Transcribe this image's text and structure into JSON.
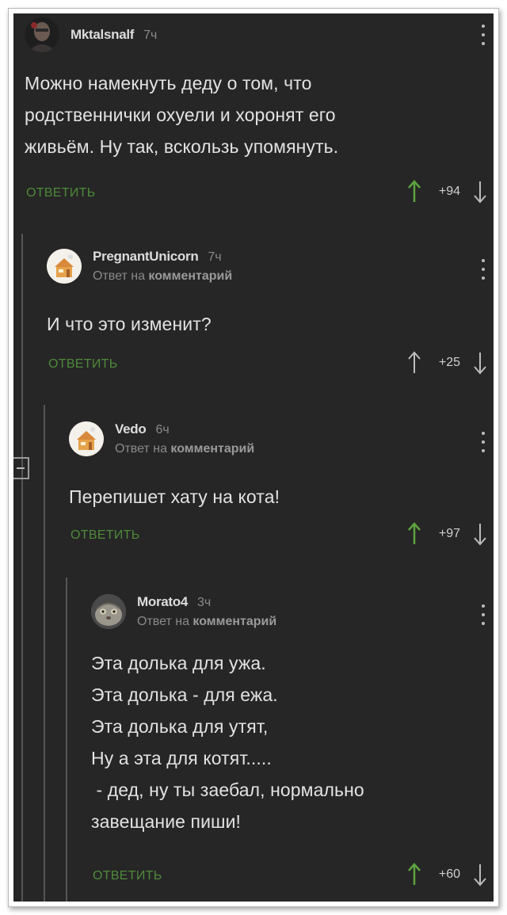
{
  "comments": [
    {
      "username": "Mktalsnalf",
      "time": "7ч",
      "reply_to": null,
      "avatar": "dark-portrait-avatar",
      "lines": [
        "Можно намекнуть деду о том, что",
        "родственнички охуели и хоронят его",
        "живьём. Ну так, вскользь упомянуть."
      ],
      "reply_label": "ОТВЕТИТЬ",
      "score": "+94"
    },
    {
      "username": "PregnantUnicorn",
      "time": "7ч",
      "reply_to": {
        "prefix": "Ответ на",
        "link": "комментарий"
      },
      "avatar": "default-house-avatar",
      "lines": [
        "И что это изменит?"
      ],
      "reply_label": "ОТВЕТИТЬ",
      "score": "+25"
    },
    {
      "username": "Vedo",
      "time": "6ч",
      "reply_to": {
        "prefix": "Ответ на",
        "link": "комментарий"
      },
      "avatar": "default-house-avatar",
      "lines": [
        "Перепишет хату на кота!"
      ],
      "reply_label": "ОТВЕТИТЬ",
      "score": "+97"
    },
    {
      "username": "Morato4",
      "time": "3ч",
      "reply_to": {
        "prefix": "Ответ на",
        "link": "комментарий"
      },
      "avatar": "manul-cat-avatar",
      "lines": [
        "Эта долька для ужа.",
        "Эта долька - для ежа.",
        "Эта долька для утят,",
        "Ну а эта для котят.....",
        " - дед, ну ты заебал, нормально",
        "завещание пиши!"
      ],
      "reply_label": "ОТВЕТИТЬ",
      "score": "+60"
    }
  ],
  "colors": {
    "background": "#262626",
    "reply_green": "#4e8a3a",
    "upvote_green": "#5fa33f",
    "text": "#e2e2e2",
    "muted": "#8a8a8a"
  }
}
